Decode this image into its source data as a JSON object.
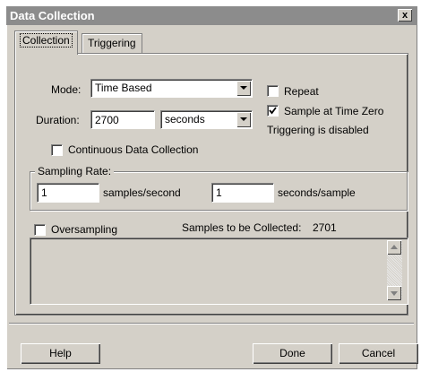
{
  "window": {
    "title": "Data Collection",
    "close_glyph": "x"
  },
  "tabs": [
    {
      "label": "Collection",
      "active": true
    },
    {
      "label": "Triggering",
      "active": false
    }
  ],
  "mode": {
    "label": "Mode:",
    "value": "Time Based"
  },
  "duration": {
    "label": "Duration:",
    "value": "2700",
    "unit": "seconds"
  },
  "options": {
    "repeat": {
      "label": "Repeat",
      "checked": false
    },
    "sample_at_zero": {
      "label": "Sample at Time Zero",
      "checked": true
    },
    "triggering_status": "Triggering is disabled",
    "continuous": {
      "label": "Continuous Data Collection",
      "checked": false
    }
  },
  "sampling": {
    "legend": "Sampling Rate:",
    "per_second_value": "1",
    "per_second_label": "samples/second",
    "per_sample_value": "1",
    "per_sample_label": "seconds/sample"
  },
  "oversampling": {
    "label": "Oversampling",
    "checked": false
  },
  "samples_collected": {
    "label": "Samples to be Collected:",
    "value": "2701"
  },
  "buttons": {
    "help": "Help",
    "done": "Done",
    "cancel": "Cancel"
  },
  "colors": {
    "titlebar": "#8c8c8c",
    "face": "#d4d0c8"
  }
}
